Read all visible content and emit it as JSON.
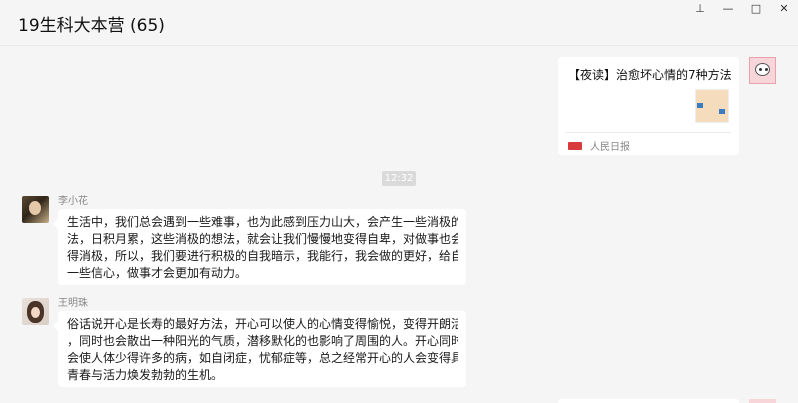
{
  "window": {
    "title": "19生科大本营 (65)",
    "controls": [
      {
        "name": "pin-icon",
        "glyph": "⊥"
      },
      {
        "name": "minimize-icon",
        "glyph": "—"
      },
      {
        "name": "maximize-icon",
        "glyph": "□"
      },
      {
        "name": "close-icon",
        "glyph": "✕"
      }
    ]
  },
  "card": {
    "title": "【夜读】治愈坏心情的7种方法",
    "source": "人民日报"
  },
  "timestamp": "12:32",
  "messages": [
    {
      "sender": "李小花",
      "lines": [
        "生活中，我们总会遇到一些难事，也为此感到压力山大，会产生一些消极的想",
        "法，日积月累，这些消极的想法，就会让我们慢慢地变得自卑，对做事也会变",
        "得消极，所以，我们要进行积极的自我暗示，我能行，我会做的更好，给自己",
        "一些信心，做事才会更加有动力。"
      ]
    },
    {
      "sender": "王明珠",
      "lines": [
        "俗话说开心是长寿的最好方法，开心可以使人的心情变得愉悦，变得开朗活泼",
        "，同时也会散出一种阳光的气质，潜移默化的也影响了周围的人。开心同时也",
        "会使人体少得许多的病，如自闭症，忧郁症等，总之经常开心的人会变得具有",
        "青春与活力焕发勃勃的生机。"
      ]
    }
  ],
  "colors": {
    "background": "#f5f5f5",
    "bubble": "#ffffff",
    "timestamp_bg": "#dadada",
    "source_logo": "#d83b3b"
  }
}
